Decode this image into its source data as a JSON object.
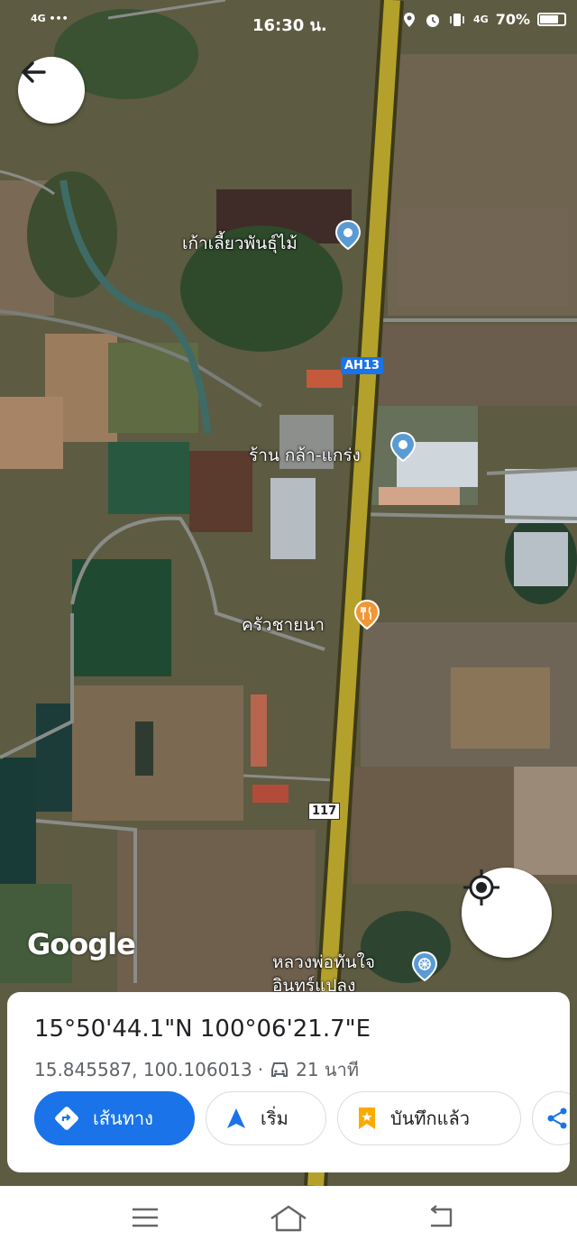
{
  "status_bar": {
    "network": "4G",
    "dots": "•••",
    "time": "16:30 น.",
    "network2": "4G",
    "battery": "70%"
  },
  "map": {
    "places": [
      {
        "name": "เก้าเลี้ยวพันธุ์ไม้",
        "type": "pin"
      },
      {
        "name": "ร้าน กล้า-แกร่ง",
        "type": "pin"
      },
      {
        "name": "ครัวชายนา",
        "type": "restaurant"
      },
      {
        "name": "หลวงพ่อทันใจ",
        "type": "temple"
      },
      {
        "name": "อินทร์แปลง",
        "type": "temple"
      }
    ],
    "road_shields": {
      "ah": "AH13",
      "route": "117"
    },
    "attribution": "Google"
  },
  "info_sheet": {
    "dms": "15°50'44.1\"N 100°06'21.7\"E",
    "decimal": "15.845587, 100.106013",
    "separator": "·",
    "travel_time": "21 นาที",
    "buttons": {
      "directions": "เส้นทาง",
      "start": "เริ่ม",
      "saved": "บันทึกแล้ว"
    }
  },
  "colors": {
    "accent": "#1a73e8",
    "road": "#b3a12c",
    "saved_icon": "#f9ab00",
    "restaurant_pin": "#f29633",
    "place_pin": "#5a9bd4"
  }
}
